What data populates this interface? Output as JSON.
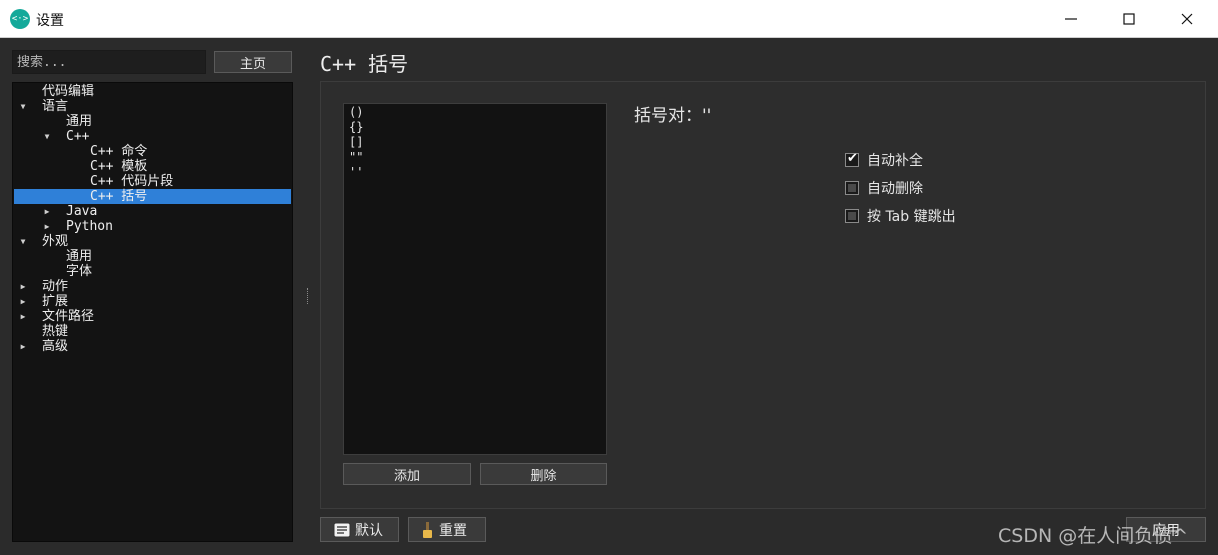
{
  "window": {
    "title": "设置",
    "app_icon_glyph": "<·>",
    "controls": [
      "minimize",
      "maximize",
      "close"
    ]
  },
  "sidebar": {
    "search_placeholder": "搜索...",
    "home_label": "主页",
    "tree": [
      {
        "label": "代码编辑",
        "level": 1,
        "arrow": "",
        "selected": false
      },
      {
        "label": "语言",
        "level": 1,
        "arrow": "down",
        "selected": false
      },
      {
        "label": "通用",
        "level": 2,
        "arrow": "",
        "selected": false
      },
      {
        "label": "C++",
        "level": 2,
        "arrow": "down",
        "selected": false
      },
      {
        "label": "C++ 命令",
        "level": 3,
        "arrow": "",
        "selected": false
      },
      {
        "label": "C++ 模板",
        "level": 3,
        "arrow": "",
        "selected": false
      },
      {
        "label": "C++ 代码片段",
        "level": 3,
        "arrow": "",
        "selected": false
      },
      {
        "label": "C++ 括号",
        "level": 3,
        "arrow": "",
        "selected": true
      },
      {
        "label": "Java",
        "level": 2,
        "arrow": "right",
        "selected": false
      },
      {
        "label": "Python",
        "level": 2,
        "arrow": "right",
        "selected": false
      },
      {
        "label": "外观",
        "level": 1,
        "arrow": "down",
        "selected": false
      },
      {
        "label": "通用",
        "level": 2,
        "arrow": "",
        "selected": false
      },
      {
        "label": "字体",
        "level": 2,
        "arrow": "",
        "selected": false
      },
      {
        "label": "动作",
        "level": 1,
        "arrow": "right",
        "selected": false
      },
      {
        "label": "扩展",
        "level": 1,
        "arrow": "right",
        "selected": false
      },
      {
        "label": "文件路径",
        "level": 1,
        "arrow": "right",
        "selected": false
      },
      {
        "label": "热键",
        "level": 1,
        "arrow": "",
        "selected": false
      },
      {
        "label": "高级",
        "level": 1,
        "arrow": "right",
        "selected": false
      }
    ]
  },
  "main": {
    "page_title": "C++ 括号",
    "pairs": [
      "()",
      "{}",
      "[]",
      "\"\"",
      "''"
    ],
    "add_label": "添加",
    "delete_label": "删除",
    "pair_heading": "括号对：''",
    "options": [
      {
        "label": "自动补全",
        "checked": true
      },
      {
        "label": "自动删除",
        "checked": false
      },
      {
        "label": "按 Tab 键跳出",
        "checked": false
      }
    ]
  },
  "footer": {
    "default_label": "默认",
    "reset_label": "重置",
    "apply_label": "应用"
  },
  "watermark": "CSDN @在人间负债^",
  "colors": {
    "selection": "#2f80d8",
    "app_icon": "#14a99a",
    "background": "#2b2b2b"
  }
}
